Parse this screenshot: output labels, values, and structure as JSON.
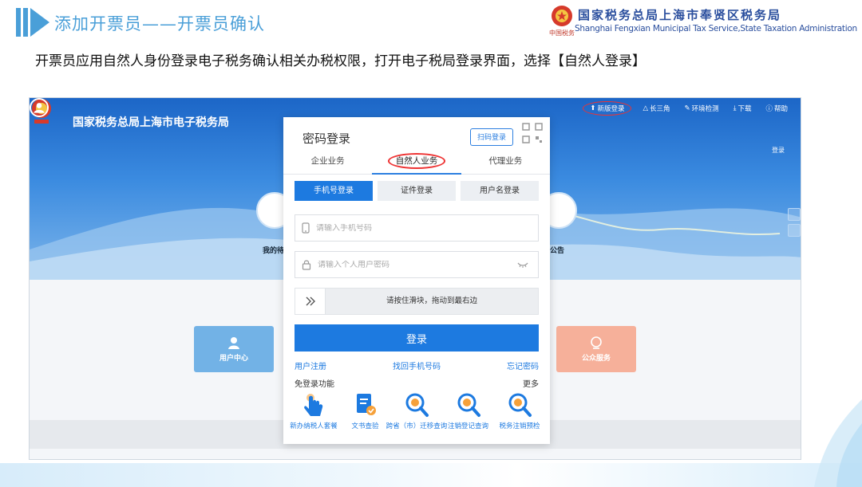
{
  "slide": {
    "title": "添加开票员——开票员确认",
    "description": "开票员应用自然人身份登录电子税务确认相关办税权限，打开电子税局登录界面，选择【自然人登录】",
    "org_cn": "国家税务总局上海市奉贤区税务局",
    "org_en": "Shanghai Fengxian Municipal Tax Service,State Taxation Administration",
    "org_sub": "中国税务",
    "accent_color": "#4a9fd8",
    "org_color": "#2b4f9e"
  },
  "portal": {
    "name": "国家税务总局上海市电子税务局",
    "logo_sub": "中国税务",
    "top_links": [
      {
        "label": "新版登录",
        "icon": "new-login-icon"
      },
      {
        "label": "长三角",
        "icon": "triangle-icon"
      },
      {
        "label": "环境检测",
        "icon": "wrench-icon"
      },
      {
        "label": "下载",
        "icon": "download-icon"
      },
      {
        "label": "帮助",
        "icon": "help-icon"
      }
    ],
    "user_label": "登录",
    "hero_captions": [
      "我的待",
      "公告"
    ],
    "tiles": {
      "user_center": "用户中心",
      "public_service": "公众服务"
    }
  },
  "login": {
    "title": "密码登录",
    "scan_button": "扫码登录",
    "biz_tabs": [
      "企业业务",
      "自然人业务",
      "代理业务"
    ],
    "method_tabs": [
      "手机号登录",
      "证件登录",
      "用户名登录"
    ],
    "phone_placeholder": "请输入手机号码",
    "password_placeholder": "请输入个人用户密码",
    "slider_text": "请按住滑块，拖动到最右边",
    "login_button": "登录",
    "links": [
      "用户注册",
      "找回手机号码",
      "忘记密码"
    ],
    "free_login_label": "免登录功能",
    "more_label": "更多",
    "shortcuts": [
      {
        "label": "新办纳税人套餐",
        "icon": "finger-tap-icon"
      },
      {
        "label": "文书查验",
        "icon": "document-check-icon"
      },
      {
        "label": "跨省（市）迁移查询",
        "icon": "search-icon"
      },
      {
        "label": "注销登记查询",
        "icon": "search-icon"
      },
      {
        "label": "税务注销预检",
        "icon": "search-icon"
      }
    ]
  }
}
